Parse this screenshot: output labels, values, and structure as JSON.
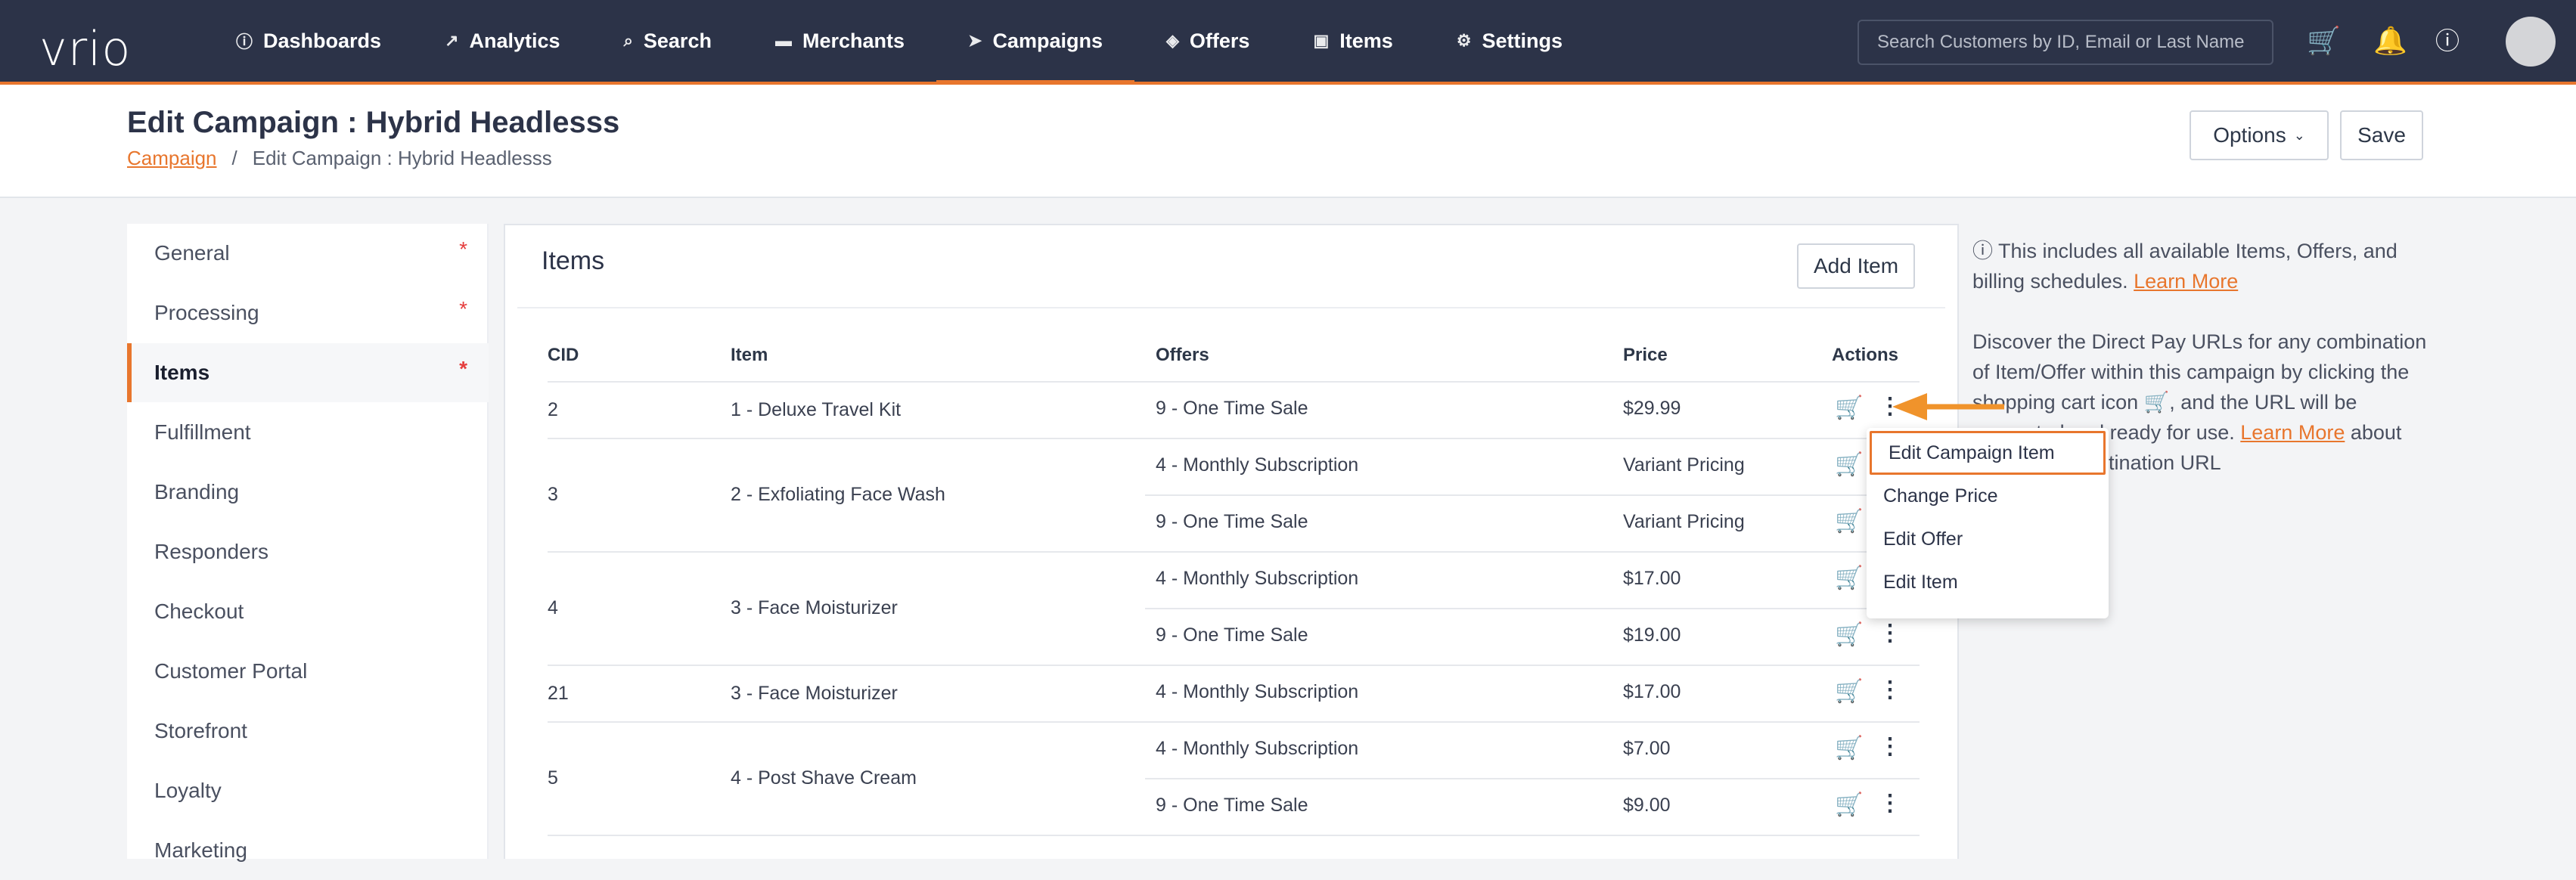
{
  "nav": {
    "logo": "vrio",
    "items": [
      {
        "label": "Dashboards",
        "icon": "ⓘ"
      },
      {
        "label": "Analytics",
        "icon": "↗"
      },
      {
        "label": "Search",
        "icon": "⌕"
      },
      {
        "label": "Merchants",
        "icon": "▬"
      },
      {
        "label": "Campaigns",
        "icon": "➤"
      },
      {
        "label": "Offers",
        "icon": "◈"
      },
      {
        "label": "Items",
        "icon": "▣"
      },
      {
        "label": "Settings",
        "icon": "⚙"
      }
    ],
    "active": "Campaigns",
    "search_placeholder": "Search Customers by ID, Email or Last Name"
  },
  "header": {
    "title": "Edit Campaign : Hybrid Headlesss",
    "crumb_link": "Campaign",
    "crumb_sep": "/",
    "crumb_current": "Edit Campaign : Hybrid Headlesss",
    "options_label": "Options",
    "save_label": "Save"
  },
  "sidebar": {
    "items": [
      {
        "label": "General",
        "req": "*"
      },
      {
        "label": "Processing",
        "req": "*"
      },
      {
        "label": "Items",
        "req": "*"
      },
      {
        "label": "Fulfillment"
      },
      {
        "label": "Branding"
      },
      {
        "label": "Responders"
      },
      {
        "label": "Checkout"
      },
      {
        "label": "Customer Portal"
      },
      {
        "label": "Storefront"
      },
      {
        "label": "Loyalty"
      },
      {
        "label": "Marketing"
      }
    ],
    "active": "Items"
  },
  "items_panel": {
    "title": "Items",
    "add_label": "Add Item",
    "columns": [
      "CID",
      "Item",
      "Offers",
      "Price",
      "Actions"
    ],
    "rows": [
      {
        "cid": "2",
        "item": "1 - Deluxe Travel Kit",
        "offers": [
          {
            "offer": "9 - One Time Sale",
            "price": "$29.99"
          }
        ]
      },
      {
        "cid": "3",
        "item": "2 - Exfoliating Face Wash",
        "offers": [
          {
            "offer": "4 - Monthly Subscription",
            "price": "Variant Pricing"
          },
          {
            "offer": "9 - One Time Sale",
            "price": "Variant Pricing"
          }
        ]
      },
      {
        "cid": "4",
        "item": "3 - Face Moisturizer",
        "offers": [
          {
            "offer": "4 - Monthly Subscription",
            "price": "$17.00"
          },
          {
            "offer": "9 - One Time Sale",
            "price": "$19.00"
          }
        ]
      },
      {
        "cid": "21",
        "item": "3 - Face Moisturizer",
        "offers": [
          {
            "offer": "4 - Monthly Subscription",
            "price": "$17.00"
          }
        ]
      },
      {
        "cid": "5",
        "item": "4 - Post Shave Cream",
        "offers": [
          {
            "offer": "4 - Monthly Subscription",
            "price": "$7.00"
          },
          {
            "offer": "9 - One Time Sale",
            "price": "$9.00"
          }
        ]
      }
    ]
  },
  "info": {
    "line1": "This includes all available Items, Offers, and billing schedules.",
    "learn_more_1": "Learn More",
    "line2a": "Discover the Direct Pay URLs for any combination of Item/Offer within this campaign by clicking the shopping cart icon",
    "line2b": ", and the URL will be generated and ready for use.",
    "learn_more_2": "Learn More",
    "line3": "about Direct Pay Destination URL"
  },
  "menu": {
    "items": [
      "Edit Campaign Item",
      "Change Price",
      "Edit Offer",
      "Edit Item"
    ]
  },
  "colors": {
    "nav_bg": "#2c3348",
    "accent": "#e8762d",
    "required": "#e53e3e"
  }
}
